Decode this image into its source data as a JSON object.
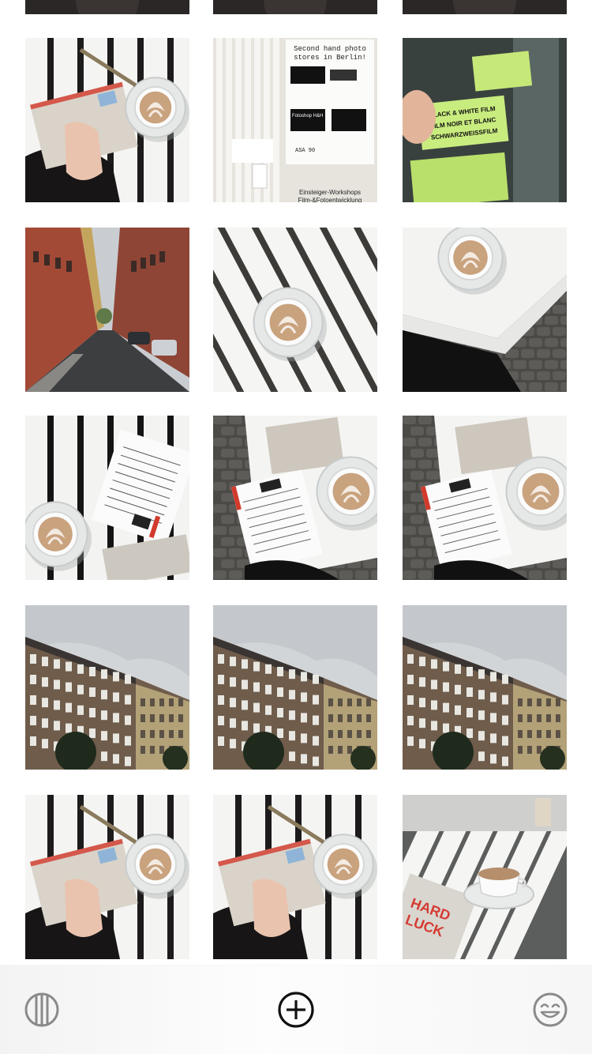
{
  "grid": {
    "columns": 3,
    "photos": [
      {
        "kind": "partial-top",
        "subject": "cut-off photo"
      },
      {
        "kind": "partial-top",
        "subject": "cut-off photo"
      },
      {
        "kind": "partial-top",
        "subject": "cut-off photo"
      },
      {
        "kind": "flatlay",
        "subject": "postcard with coffee cup"
      },
      {
        "kind": "flyer",
        "subject": "flyer on radiator",
        "text_top": "Second hand photo stores in Berlin!",
        "text_bottom": "Einsteiger-Workshops Film-&Fotoentwicklung",
        "text_mid": "Fotoshop H&H"
      },
      {
        "kind": "filmbox",
        "subject": "film boxes",
        "label": "BLACK & WHITE FILM FILM NOIR ET BLANC SCHWARZWEISSFILM"
      },
      {
        "kind": "street",
        "subject": "street between buildings"
      },
      {
        "kind": "coffee",
        "subject": "coffee cup on white bench"
      },
      {
        "kind": "coffee2",
        "subject": "coffee cup near cobblestones"
      },
      {
        "kind": "letter",
        "subject": "letter and coffee"
      },
      {
        "kind": "letter2",
        "subject": "letter writing and coffee"
      },
      {
        "kind": "letter2",
        "subject": "letter writing and coffee"
      },
      {
        "kind": "building",
        "subject": "apartment building facade"
      },
      {
        "kind": "building",
        "subject": "apartment building facade"
      },
      {
        "kind": "building",
        "subject": "apartment building facade"
      },
      {
        "kind": "flatlay",
        "subject": "postcard with coffee cup"
      },
      {
        "kind": "flatlay",
        "subject": "postcard with coffee cup"
      },
      {
        "kind": "table",
        "subject": "coffee cup on white table",
        "book_text": "HARD LUCK"
      }
    ]
  },
  "toolbar": {
    "left_icon": "columns-grid-icon",
    "center_icon": "add-circle-icon",
    "right_icon": "smiley-icon",
    "icon_color": "#8a8a8a",
    "center_color": "#111111"
  }
}
